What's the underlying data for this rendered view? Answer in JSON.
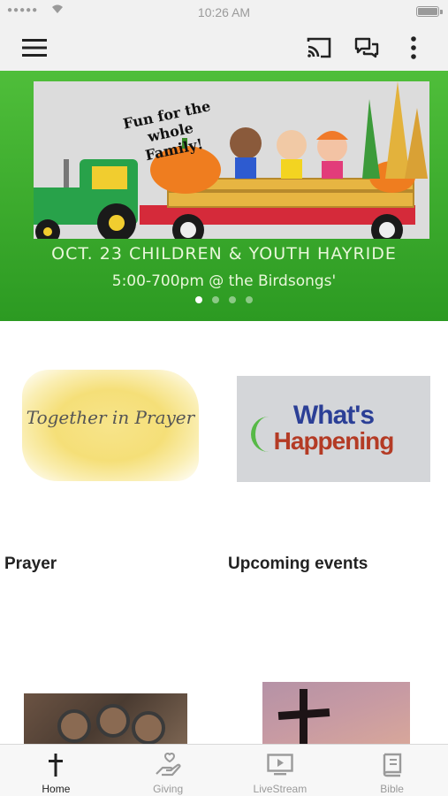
{
  "status_bar": {
    "signal": "●●●●●",
    "time": "10:26 AM"
  },
  "app_bar": {
    "menu_icon": "hamburger-icon",
    "cast_icon": "cast-icon",
    "chat_icon": "chat-bubbles-icon",
    "more_icon": "more-vert-icon"
  },
  "banner": {
    "tagline": "Fun for the whole Family!",
    "headline": "OCT. 23 CHILDREN & YOUTH HAYRIDE",
    "subline": "5:00-700pm @ the Birdsongs'",
    "slide_count": 4,
    "active_slide": 1
  },
  "cards": [
    {
      "caption": "Prayer",
      "image_text": "Together in Prayer"
    },
    {
      "caption": "Upcoming events",
      "image_text_1": "What's",
      "image_text_2": "Happening"
    }
  ],
  "tabs": [
    {
      "label": "Home",
      "icon": "cross-icon",
      "active": true
    },
    {
      "label": "Giving",
      "icon": "giving-hand-icon",
      "active": false
    },
    {
      "label": "LiveStream",
      "icon": "tv-play-icon",
      "active": false
    },
    {
      "label": "Bible",
      "icon": "book-icon",
      "active": false
    }
  ],
  "colors": {
    "banner_green": "#3bab2c",
    "app_bar": "#f1f1f1",
    "events_blue": "#2b3f96",
    "events_red": "#b43b25"
  }
}
